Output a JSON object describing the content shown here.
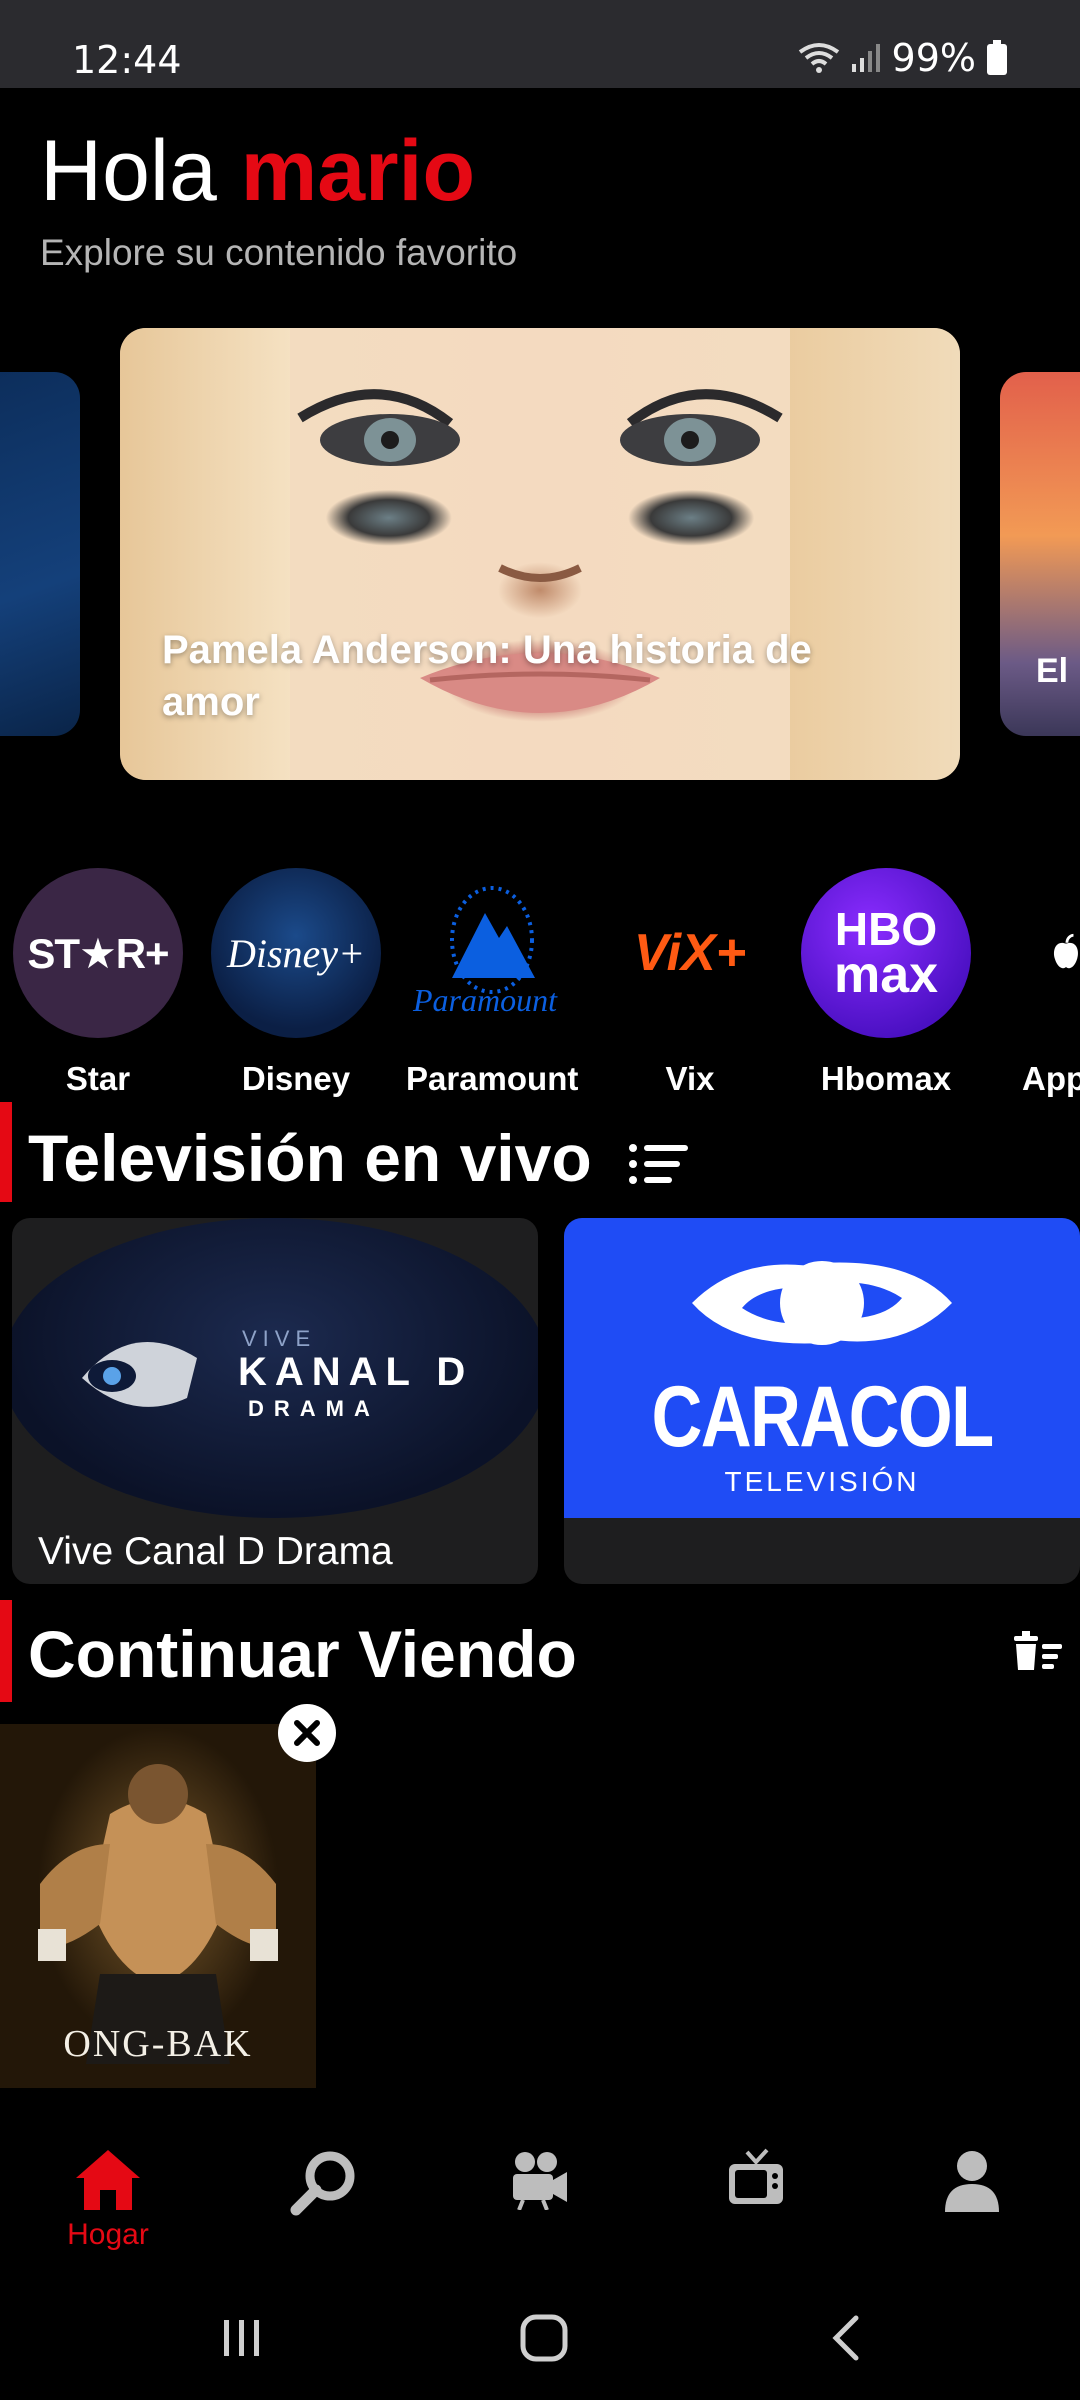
{
  "status_bar": {
    "time": "12:44",
    "battery": "99%"
  },
  "header": {
    "greeting": "Hola",
    "user_name": "mario",
    "subtitle": "Explore su contenido favorito"
  },
  "carousel": {
    "items": [
      {
        "title": ""
      },
      {
        "title": "Pamela Anderson: Una historia de amor"
      },
      {
        "title": "El"
      }
    ]
  },
  "providers": [
    {
      "label": "Star",
      "icon": "star-plus-logo"
    },
    {
      "label": "Disney",
      "icon": "disney-plus-logo"
    },
    {
      "label": "Paramount",
      "icon": "paramount-logo"
    },
    {
      "label": "Vix",
      "icon": "vix-logo"
    },
    {
      "label": "Hbomax",
      "icon": "hbo-max-logo"
    },
    {
      "label": "App",
      "icon": "apple-tv-logo"
    }
  ],
  "provider_logo_text": {
    "star": "ST★R+",
    "disney": "Disney+",
    "paramount": "Paramount",
    "vix": "ViX+",
    "hbo_top": "HBO",
    "hbo_bottom": "max"
  },
  "live_tv": {
    "title": "Televisión en vivo",
    "channels": [
      {
        "label": "Vive Canal D Drama",
        "logo_small": "VIVE",
        "logo_main": "KANAL D",
        "logo_sub": "DRAMA"
      },
      {
        "label": "",
        "logo_main": "CARACOL",
        "logo_sub": "TELEVISIÓN"
      }
    ]
  },
  "continue_watching": {
    "title": "Continuar Viendo",
    "items": [
      {
        "title": "ONG-BAK"
      }
    ]
  },
  "bottom_nav": {
    "items": [
      {
        "label": "Hogar",
        "icon": "home-icon",
        "active": true
      },
      {
        "label": "",
        "icon": "search-icon"
      },
      {
        "label": "",
        "icon": "movie-camera-icon"
      },
      {
        "label": "",
        "icon": "tv-icon"
      },
      {
        "label": "",
        "icon": "profile-icon"
      }
    ]
  },
  "colors": {
    "accent": "#e50914",
    "background": "#000000",
    "status_bar": "#2b2b2f",
    "caracol_blue": "#1f4cf5"
  }
}
